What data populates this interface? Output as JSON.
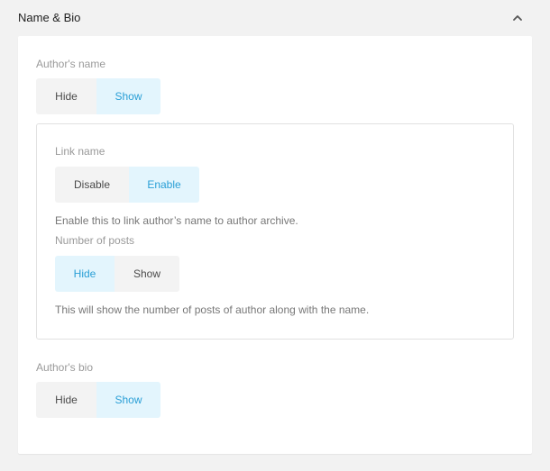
{
  "section": {
    "title": "Name & Bio"
  },
  "authors_name": {
    "label": "Author's name",
    "options": [
      "Hide",
      "Show"
    ],
    "selected": "Show"
  },
  "link_name": {
    "label": "Link name",
    "options": [
      "Disable",
      "Enable"
    ],
    "selected": "Enable",
    "help": "Enable this to link author’s name to author archive."
  },
  "number_of_posts": {
    "label": "Number of posts",
    "options": [
      "Hide",
      "Show"
    ],
    "selected": "Hide",
    "help": "This will show the number of posts of author along with the name."
  },
  "authors_bio": {
    "label": "Author's bio",
    "options": [
      "Hide",
      "Show"
    ],
    "selected": "Show"
  },
  "colors": {
    "accent": "#2a9fd6",
    "active_bg": "#e3f5fd",
    "inactive_bg": "#f3f3f3",
    "panel_bg": "#f2f2f2"
  },
  "icons": {
    "collapse": "chevron-up-icon"
  }
}
